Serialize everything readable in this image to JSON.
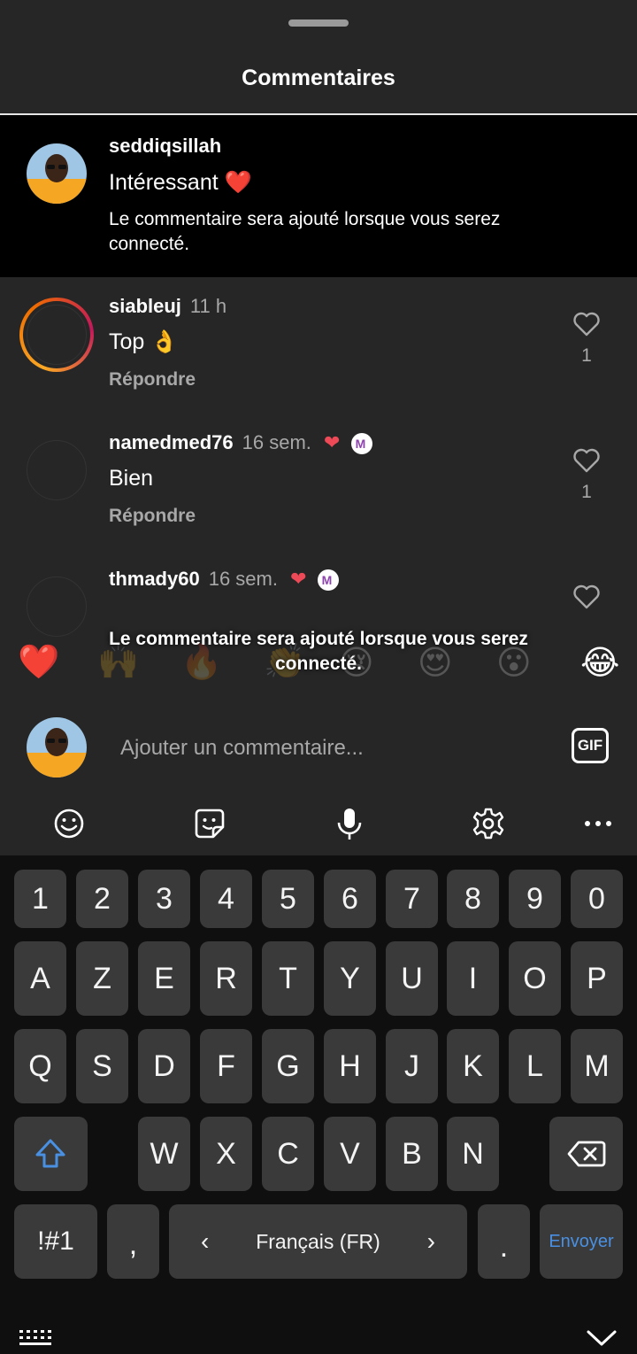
{
  "sheet": {
    "title": "Commentaires"
  },
  "pending_comment": {
    "username": "seddiqsillah",
    "text": "Intéressant",
    "text_emoji": "❤️",
    "note": "Le commentaire sera ajouté lorsque vous serez connecté."
  },
  "comments": [
    {
      "username": "siableuj",
      "time": "11 h",
      "text": "Top 👌",
      "reply": "Répondre",
      "likes": "1"
    },
    {
      "username": "namedmed76",
      "time": "16 sem.",
      "text": "Bien",
      "reply": "Répondre",
      "likes": "1"
    },
    {
      "username": "thmady60",
      "time": "16 sem."
    }
  ],
  "toast": "Le commentaire sera ajouté lorsque vous serez connecté.",
  "emoji_bar": [
    "❤️",
    "🙌",
    "🔥",
    "👏",
    "😢",
    "😍",
    "😮",
    "😂"
  ],
  "composer": {
    "placeholder": "Ajouter un commentaire...",
    "gif_label": "GIF"
  },
  "keyboard": {
    "toolbar_icons": [
      "emoji-icon",
      "sticker-icon",
      "microphone-icon",
      "settings-icon",
      "more-icon"
    ],
    "row_numbers": [
      "1",
      "2",
      "3",
      "4",
      "5",
      "6",
      "7",
      "8",
      "9",
      "0"
    ],
    "row_1": [
      "A",
      "Z",
      "E",
      "R",
      "T",
      "Y",
      "U",
      "I",
      "O",
      "P"
    ],
    "row_2": [
      "Q",
      "S",
      "D",
      "F",
      "G",
      "H",
      "J",
      "K",
      "L",
      "M"
    ],
    "row_3": [
      "W",
      "X",
      "C",
      "V",
      "B",
      "N"
    ],
    "symbols_label": "!#1",
    "comma": ",",
    "language": "Français (FR)",
    "period": ".",
    "send_label": "Envoyer"
  },
  "colors": {
    "accent_blue": "#4a90e2",
    "heart_red": "#ed4956",
    "story_ring_start": "#f9a825",
    "story_ring_end": "#c2185b"
  }
}
